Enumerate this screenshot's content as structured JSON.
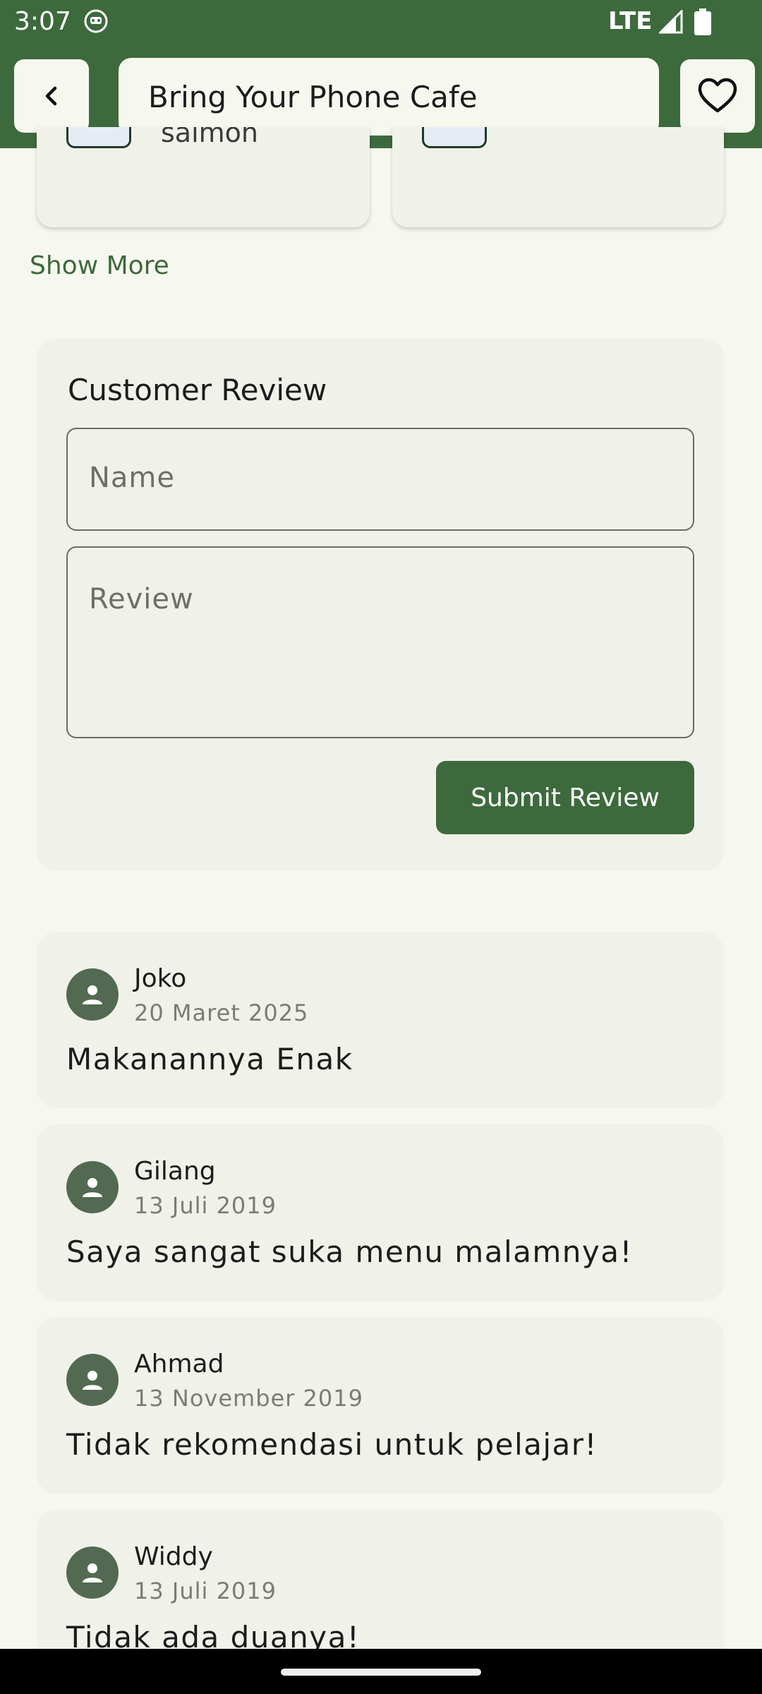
{
  "status_bar": {
    "time": "3:07",
    "network": "LTE",
    "icons": [
      "app-notification-icon",
      "signal-icon",
      "battery-icon"
    ]
  },
  "app_bar": {
    "title": "Bring Your Phone Cafe",
    "back_icon": "chevron-left-icon",
    "favorite_icon": "heart-outline-icon"
  },
  "menu_cards": [
    {
      "partial_text": "salmon"
    },
    {
      "partial_text": ""
    }
  ],
  "show_more_label": "Show More",
  "review_form": {
    "title": "Customer Review",
    "name_placeholder": "Name",
    "review_placeholder": "Review",
    "submit_label": "Submit Review"
  },
  "reviews": [
    {
      "name": "Joko",
      "date": "20 Maret 2025",
      "text": "Makanannya Enak"
    },
    {
      "name": "Gilang",
      "date": "13 Juli 2019",
      "text": "Saya sangat suka menu malamnya!"
    },
    {
      "name": "Ahmad",
      "date": "13 November 2019",
      "text": "Tidak rekomendasi untuk pelajar!"
    },
    {
      "name": "Widdy",
      "date": "13 Juli 2019",
      "text": "Tidak ada duanya!"
    }
  ],
  "colors": {
    "primary": "#3d6a3c",
    "background": "#f6f8f0",
    "card": "#f0f2ea",
    "avatar": "#526a52"
  }
}
